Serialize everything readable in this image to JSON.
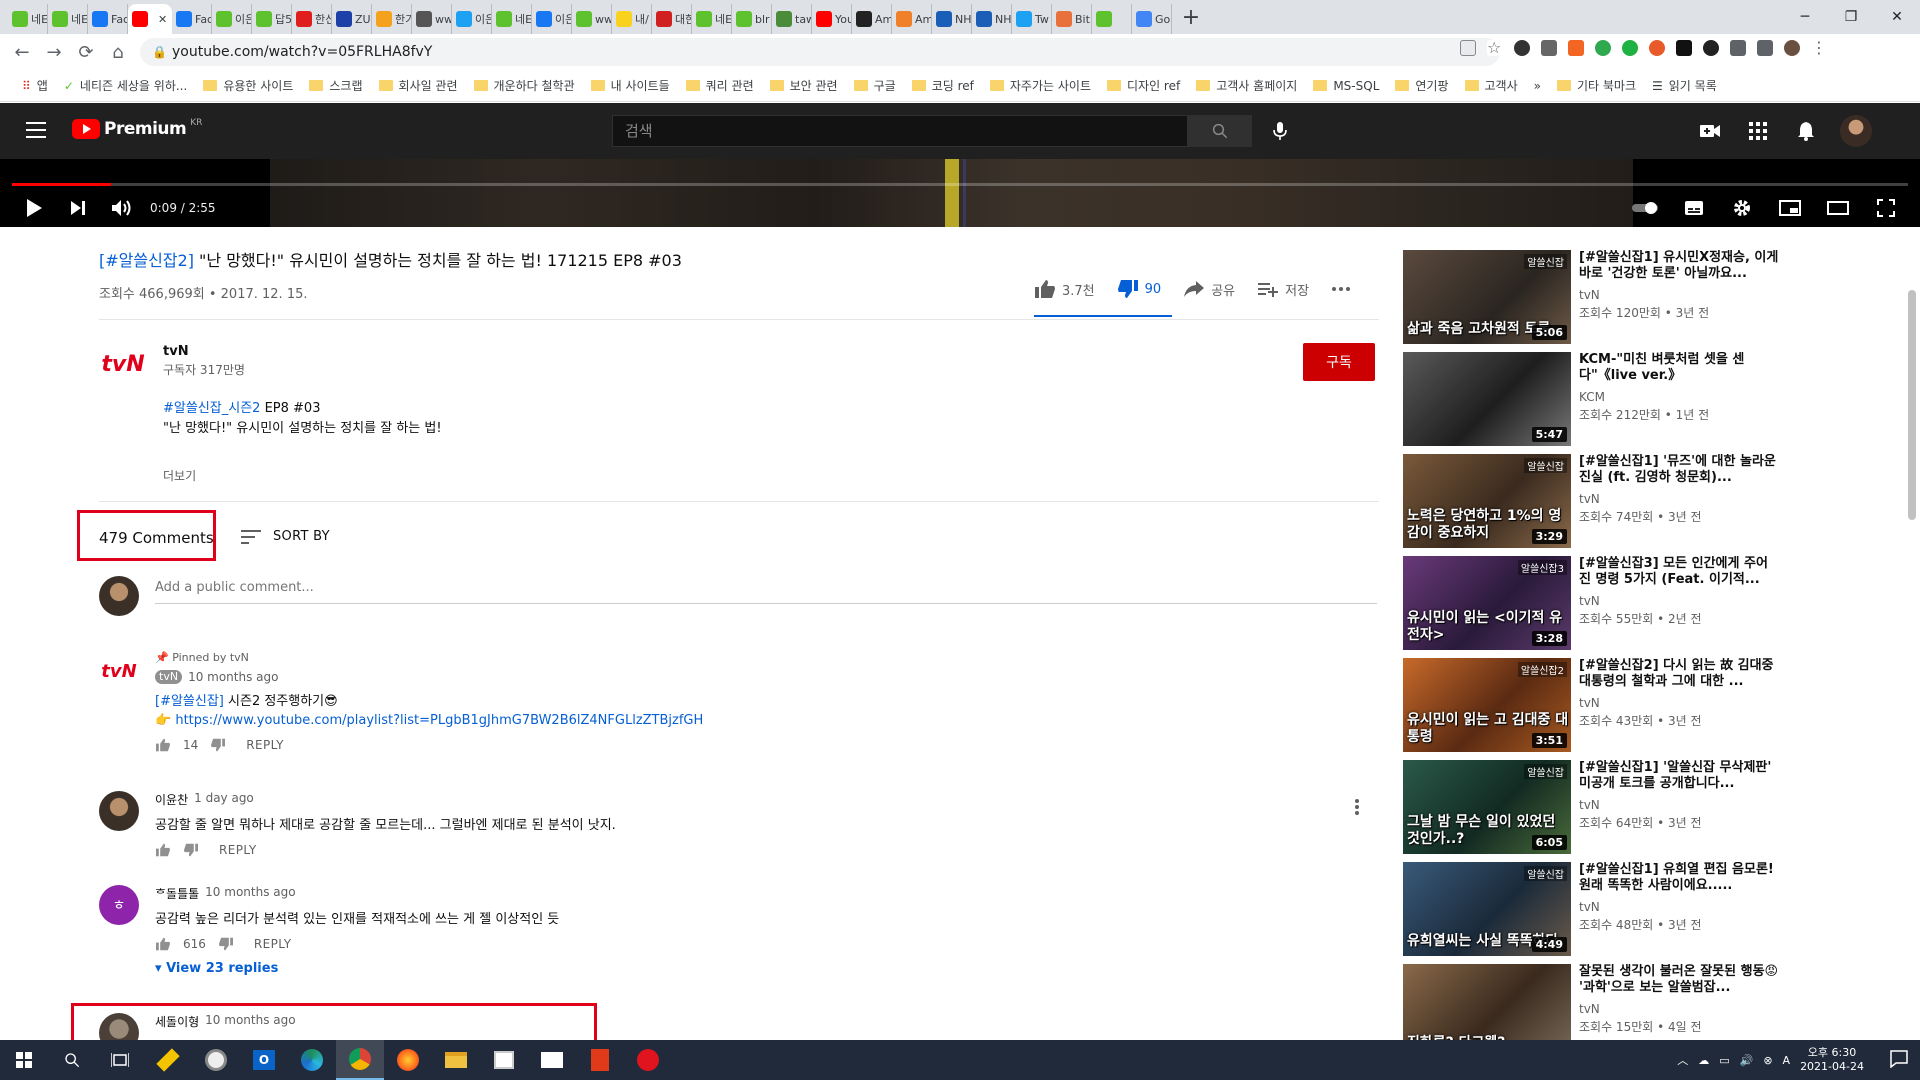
{
  "browser": {
    "tabs": [
      {
        "label": "네E",
        "color": "#5ec22f"
      },
      {
        "label": "네E",
        "color": "#5ec22f"
      },
      {
        "label": "Fac",
        "color": "#1877f2"
      },
      {
        "label": "",
        "color": "#ff0000",
        "active": true
      },
      {
        "label": "Fac",
        "color": "#1877f2"
      },
      {
        "label": "이은",
        "color": "#5ec22f"
      },
      {
        "label": "답5",
        "color": "#5ec22f"
      },
      {
        "label": "한신",
        "color": "#e01e1e"
      },
      {
        "label": "ZU",
        "color": "#1c3fa8"
      },
      {
        "label": "한기",
        "color": "#f4a21e"
      },
      {
        "label": "ww",
        "color": "#555555"
      },
      {
        "label": "이은",
        "color": "#1da1f2"
      },
      {
        "label": "네E",
        "color": "#5ec22f"
      },
      {
        "label": "이은",
        "color": "#1877f2"
      },
      {
        "label": "ww",
        "color": "#5ec22f"
      },
      {
        "label": "내/",
        "color": "#f7d21e"
      },
      {
        "label": "대한",
        "color": "#d02020"
      },
      {
        "label": "네E",
        "color": "#5ec22f"
      },
      {
        "label": "blr",
        "color": "#5ec22f"
      },
      {
        "label": "taw",
        "color": "#4a8c3a"
      },
      {
        "label": "You",
        "color": "#ff0000"
      },
      {
        "label": "Am",
        "color": "#222222"
      },
      {
        "label": "Am",
        "color": "#f0802a"
      },
      {
        "label": "NH",
        "color": "#1a5eb8"
      },
      {
        "label": "NH",
        "color": "#1a5eb8"
      },
      {
        "label": "Tw",
        "color": "#1da1f2"
      },
      {
        "label": "Bit",
        "color": "#e8703a"
      },
      {
        "label": "",
        "color": "#5ec22f"
      },
      {
        "label": "Go",
        "color": "#4285f4"
      }
    ],
    "address": "youtube.com/watch?v=05FRLHA8fvY",
    "bookmarks": [
      {
        "label": "앱",
        "type": "apps"
      },
      {
        "label": "네티즌 세상을 위하...",
        "type": "site"
      },
      {
        "label": "유용한 사이트",
        "type": "folder"
      },
      {
        "label": "스크랩",
        "type": "folder"
      },
      {
        "label": "회사일 관련",
        "type": "folder"
      },
      {
        "label": "개운하다 철학관",
        "type": "folder"
      },
      {
        "label": "내 사이트들",
        "type": "folder"
      },
      {
        "label": "쿼리 관련",
        "type": "folder"
      },
      {
        "label": "보안 관련",
        "type": "folder"
      },
      {
        "label": "구글",
        "type": "folder"
      },
      {
        "label": "코딩 ref",
        "type": "folder"
      },
      {
        "label": "자주가는 사이트",
        "type": "folder"
      },
      {
        "label": "디자인 ref",
        "type": "folder"
      },
      {
        "label": "고객사 홈페이지",
        "type": "folder"
      },
      {
        "label": "MS-SQL",
        "type": "folder"
      },
      {
        "label": "연기팡",
        "type": "folder"
      },
      {
        "label": "고객사",
        "type": "folder"
      }
    ],
    "bookmarks_more": "»",
    "other_bookmarks": "기타 북마크",
    "reading_list": "읽기 목록"
  },
  "youtube": {
    "logo_text": "Premium",
    "logo_region": "KR",
    "search_placeholder": "검색"
  },
  "player": {
    "time": "0:09 / 2:55",
    "progress_fraction": 0.052
  },
  "video": {
    "title_hashtag": "[#알쓸신잡2]",
    "title_rest": " \"난 망했다!\" 유시민이 설명하는 정치를 잘 하는 법! 171215 EP8 #03",
    "meta": "조회수 466,969회 • 2017. 12. 15.",
    "likes": "3.7천",
    "dislikes": "90",
    "share": "공유",
    "save": "저장"
  },
  "channel": {
    "logo": "tvN",
    "name": "tvN",
    "subscribers": "구독자 317만명",
    "subscribe_label": "구독",
    "desc_hashtag": "#알쓸신잡_시즌2",
    "desc_hashtag_rest": " EP8 #03",
    "desc_line2": "\"난 망했다!\" 유시민이 설명하는 정치를 잘 하는 법!",
    "more": "더보기"
  },
  "comments": {
    "count": "479 Comments",
    "sort_by": "SORT BY",
    "add_placeholder": "Add a public comment...",
    "items": [
      {
        "pinned": "Pinned by tvN",
        "author": "tvN",
        "time": "10 months ago",
        "text_hashtag": "[#알쓸신잡]",
        "text_rest": " 시즌2 정주행하기😎",
        "link_emoji": "👉",
        "link": "https://www.youtube.com/playlist?list=PLgbB1gJhmG7BW2B6lZ4NFGLlzZTBjzfGH",
        "likes": "14",
        "reply": "REPLY"
      },
      {
        "author": "이윤찬",
        "time": "1 day ago",
        "text": "공감할 줄 알면 뭐하나 제대로 공감할 줄 모르는데... 그럴바엔 제대로 된 분석이 낫지.",
        "likes": "",
        "reply": "REPLY"
      },
      {
        "author": "ᄒ돌틀톨",
        "avatar_letter": "ㅎ",
        "time": "10 months ago",
        "text": "공감력 높은 리더가 분석력 있는 인재를 적재적소에 쓰는 게 젤 이상적인 듯",
        "likes": "616",
        "reply": "REPLY",
        "view_replies": "View 23 replies"
      },
      {
        "author": "세돌이형",
        "time": "10 months ago"
      }
    ]
  },
  "sidebar": {
    "videos": [
      {
        "title": "[#알쓸신잡1] 유시민X정재승, 이게 바로 '건강한 토론' 아닐까요...",
        "channel": "tvN",
        "meta": "조회수 120만회 • 3년 전",
        "duration": "5:06",
        "caption": "삶과 죽음 고차원적 토론",
        "tag": "알쓸신잡",
        "bg": "linear-gradient(135deg,#5b4a3e,#2a2520 60%,#6e5a48)"
      },
      {
        "title": "KCM-\"미친 벼룻처럼 셋을 센다\"《live ver.》",
        "channel": "KCM",
        "meta": "조회수 212만회 • 1년 전",
        "duration": "5:47",
        "caption": "",
        "tag": "",
        "bg": "linear-gradient(135deg,#5a5a5a,#1e1e1e 55%,#777)"
      },
      {
        "title": "[#알쓸신잡1] '뮤즈'에 대한 놀라운 진실 (ft. 김영하 청문회)...",
        "channel": "tvN",
        "meta": "조회수 74만회 • 3년 전",
        "duration": "3:29",
        "caption": "노력은 당연하고 1%의 영감이 중요하지",
        "tag": "알쓸신잡",
        "bg": "linear-gradient(135deg,#7a5a3a,#3a2a1e 55%,#8a6a4a)"
      },
      {
        "title": "[#알쓸신잡3] 모든 인간에게 주어진 명령 5가지 (Feat. 이기적...",
        "channel": "tvN",
        "meta": "조회수 55만회 • 2년 전",
        "duration": "3:28",
        "caption": "유시민이 읽는 <이기적 유전자>",
        "tag": "알쓸신잡3",
        "bg": "linear-gradient(135deg,#6a3a7a,#2a1a3a 55%,#5a3a6a)"
      },
      {
        "title": "[#알쓸신잡2] 다시 읽는 故 김대중 대통령의 철학과 그에 대한 ...",
        "channel": "tvN",
        "meta": "조회수 43만회 • 3년 전",
        "duration": "3:51",
        "caption": "유시민이 읽는 고 김대중 대통령",
        "tag": "알쓸신잡2",
        "bg": "linear-gradient(135deg,#c86a2a,#5a2a12 55%,#a85a22)"
      },
      {
        "title": "[#알쓸신잡1] '알쓸신잡 무삭제판' 미공개 토크를 공개합니다...",
        "channel": "tvN",
        "meta": "조회수 64만회 • 3년 전",
        "duration": "6:05",
        "caption": "그날 밤 무슨 일이 있었던 것인가..?",
        "tag": "알쓸신잡",
        "bg": "linear-gradient(135deg,#2a5a4a,#122a22 55%,#4a6a3a)"
      },
      {
        "title": "[#알쓸신잡1] 유희열 편집 음모론! 원래 똑똑한 사람이에요.....",
        "channel": "tvN",
        "meta": "조회수 48만회 • 3년 전",
        "duration": "4:49",
        "caption": "유희열씨는 사실 똑똑하다",
        "tag": "알쓸신잡",
        "bg": "linear-gradient(135deg,#3a5a7a,#1a2a3a 55%,#6a5a4a)"
      },
      {
        "title": "잘못된 생각이 불러온 잘못된 행동😡 '과학'으로 보는 알쓸범잡...",
        "channel": "tvN",
        "meta": "조회수 15만회 • 4일 전",
        "duration": "",
        "caption": "진화론? 다크웹?",
        "tag": "",
        "bg": "linear-gradient(135deg,#8a6a4a,#3a2a1e 55%,#7a6a5a)"
      }
    ]
  },
  "taskbar": {
    "time": "오후 6:30",
    "date": "2021-04-24",
    "ime": "A"
  }
}
